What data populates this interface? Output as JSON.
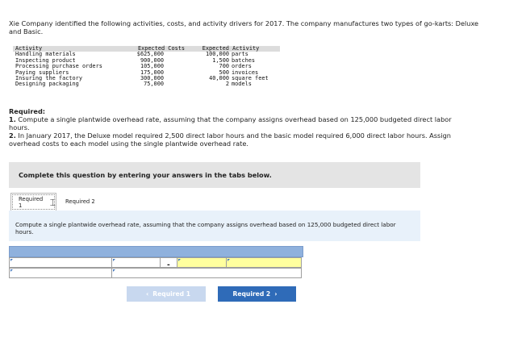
{
  "intro_text": "Xie Company identified the following activities, costs, and activity drivers for 2017. The company manufactures two types of go-karts: Deluxe and Basic.",
  "activity_table": {
    "headers": [
      "Activity",
      "Expected Costs",
      "Expected Activity"
    ],
    "rows": [
      {
        "activity": "Handling materials",
        "cost": "$625,000",
        "qty": "100,000",
        "unit": "parts"
      },
      {
        "activity": "Inspecting product",
        "cost": "900,000",
        "qty": "1,500",
        "unit": "batches"
      },
      {
        "activity": "Processing purchase orders",
        "cost": "105,000",
        "qty": "700",
        "unit": "orders"
      },
      {
        "activity": "Paying suppliers",
        "cost": "175,000",
        "qty": "500",
        "unit": "invoices"
      },
      {
        "activity": "Insuring the factory",
        "cost": "300,000",
        "qty": "40,000",
        "unit": "square feet"
      },
      {
        "activity": "Designing packaging",
        "cost": "75,000",
        "qty": "2",
        "unit": "models"
      }
    ]
  },
  "required": {
    "heading": "Required:",
    "item1_num": "1.",
    "item1": "Compute a single plantwide overhead rate, assuming that the company assigns overhead based on 125,000 budgeted direct labor hours.",
    "item2_num": "2.",
    "item2": "In January 2017, the Deluxe model required 2,500 direct labor hours and the basic model required 6,000 direct labor hours. Assign overhead costs to each model using the single plantwide overhead rate."
  },
  "instruction": "Complete this question by entering your answers in the tabs below.",
  "tabs": [
    {
      "label": "Required 1"
    },
    {
      "label": "Required 2"
    }
  ],
  "question_text": "Compute a single plantwide overhead rate, assuming that the company assigns overhead based on 125,000 budgeted direct labor hours.",
  "answer_table": {
    "operator": "-"
  },
  "buttons": {
    "prev_label": "Required 1",
    "next_label": "Required 2",
    "prev_icon": "chevron-left-icon",
    "next_icon": "chevron-right-icon"
  },
  "colors": {
    "button_blue": "#2f6bb8",
    "panel_blue": "#e8f1fa",
    "input_yellow": "#ffff9e"
  }
}
